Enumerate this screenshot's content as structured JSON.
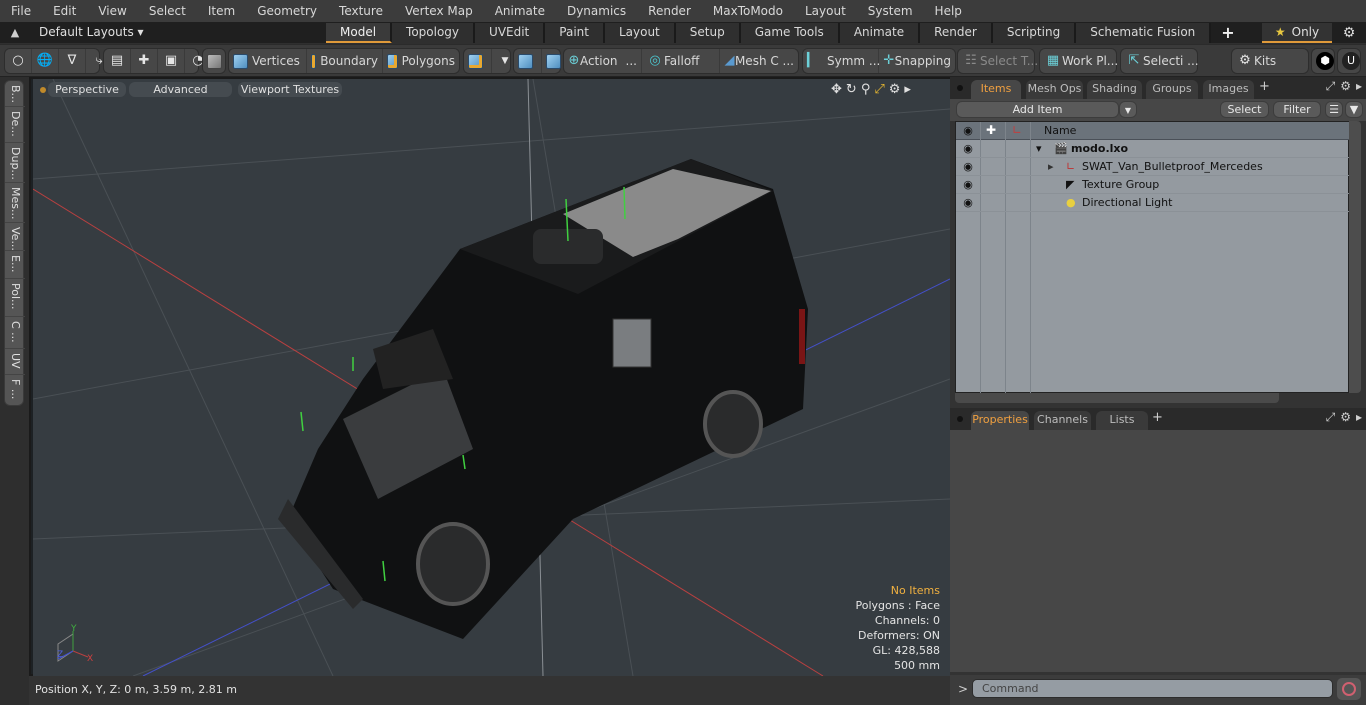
{
  "menu": [
    "File",
    "Edit",
    "View",
    "Select",
    "Item",
    "Geometry",
    "Texture",
    "Vertex Map",
    "Animate",
    "Dynamics",
    "Render",
    "MaxToModo",
    "Layout",
    "System",
    "Help"
  ],
  "layout_bar": {
    "layouts_label": "Default Layouts ▾",
    "tabs": [
      "Model",
      "Topology",
      "UVEdit",
      "Paint",
      "Layout",
      "Setup",
      "Game Tools",
      "Animate",
      "Render",
      "Scripting",
      "Schematic Fusion"
    ],
    "active_tab": "Model",
    "add_tab": "+",
    "only_label": "Only",
    "star": "★",
    "gear": "⚙"
  },
  "toolbar": {
    "vertices": "Vertices",
    "boundary": "Boundary",
    "polygons": "Polygons",
    "action": "Action",
    "falloff": "Falloff",
    "mesh_c": "Mesh C ...",
    "symm": "Symm ...",
    "snapping": "Snapping",
    "select_t": "Select T...",
    "work_pl": "Work Pl...",
    "selecti": "Selecti ...",
    "kits": "Kits",
    "ellipsis": "..."
  },
  "left_tabs": [
    "B...",
    "De...",
    "Dup...",
    "Mes...",
    "Ve...",
    "E...",
    "Pol...",
    "C ...",
    "UV",
    "F ..."
  ],
  "viewport": {
    "view_mode": "Perspective",
    "shading": "Advanced",
    "textures": "Viewport Textures",
    "hud": {
      "selection": "No Items",
      "polygons": "Polygons : Face",
      "channels": "Channels: 0",
      "deformers": "Deformers: ON",
      "gl": "GL: 428,588",
      "scale": "500 mm"
    },
    "axis_labels": {
      "x": "X",
      "y": "Y",
      "z": "Z"
    },
    "colors": {
      "background": "#363c41",
      "x_axis": "#c84040",
      "y_axis": "#40c040",
      "z_axis": "#4050d0",
      "hud_accent": "#f0b040"
    }
  },
  "status_bar": {
    "position": "Position X, Y, Z:   0 m, 3.59 m, 2.81 m"
  },
  "items_panel": {
    "tabs": [
      "Items",
      "Mesh Ops",
      "Shading",
      "Groups",
      "Images"
    ],
    "active_tab": "Items",
    "add_item": "Add Item",
    "select": "Select",
    "filter": "Filter",
    "column_name": "Name",
    "rows": [
      {
        "name": "modo.lxo",
        "bold": true,
        "icon": "scene-icon",
        "expander": "▾"
      },
      {
        "name": "SWAT_Van_Bulletproof_Mercedes",
        "bold": false,
        "icon": "mesh-locator-icon",
        "expander": "▸"
      },
      {
        "name": "Texture Group",
        "bold": false,
        "icon": "texture-group-icon",
        "expander": ""
      },
      {
        "name": "Directional Light",
        "bold": false,
        "icon": "light-icon",
        "expander": ""
      }
    ]
  },
  "properties_panel": {
    "tabs": [
      "Properties",
      "Channels",
      "Lists"
    ],
    "active_tab": "Properties"
  },
  "command_bar": {
    "prompt": ">",
    "placeholder": "Command"
  }
}
